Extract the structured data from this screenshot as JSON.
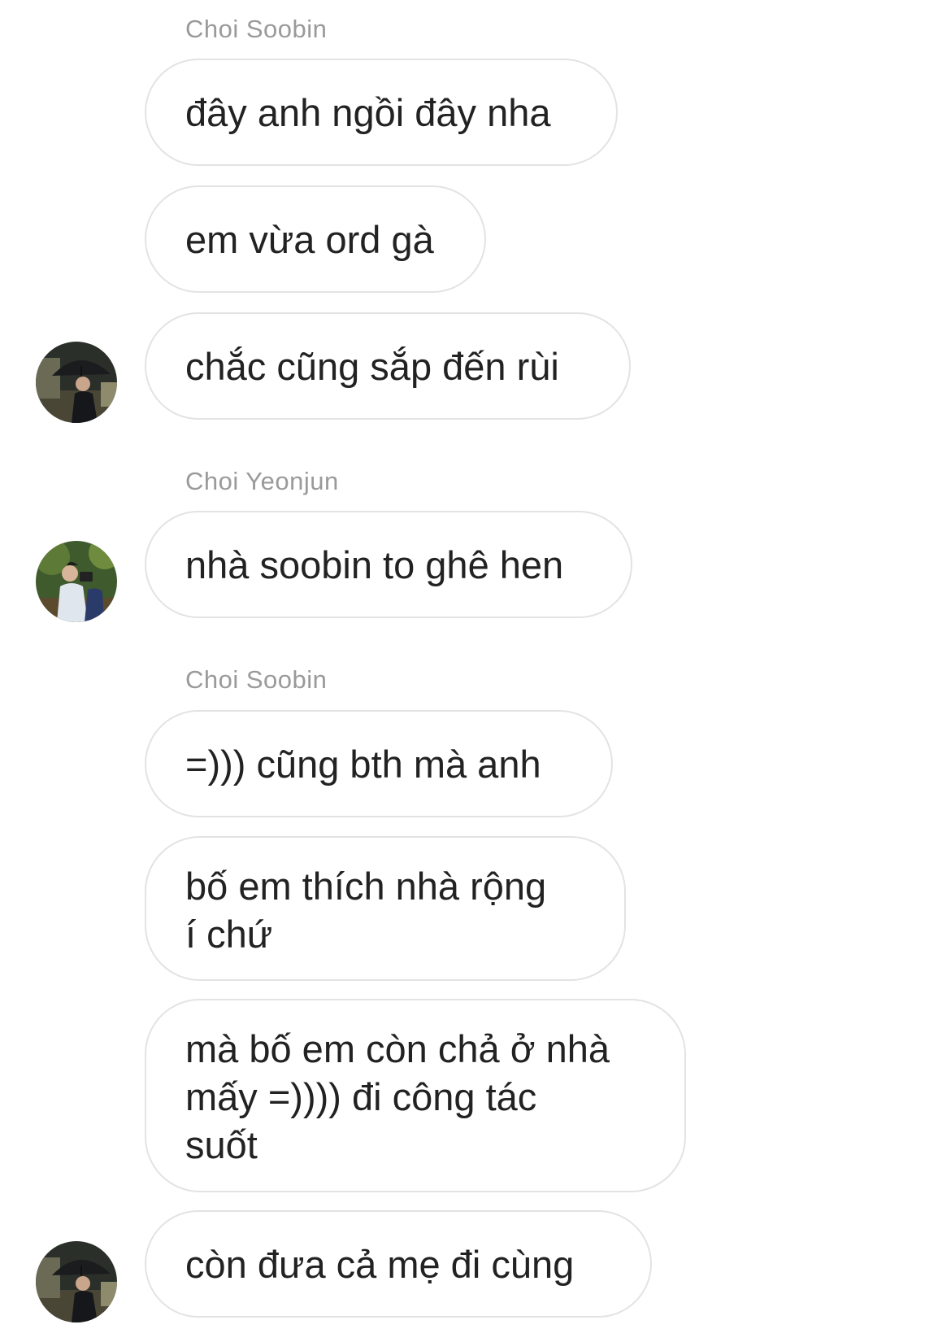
{
  "chat": {
    "groups": [
      {
        "sender": "Choi Soobin",
        "messages": [
          "đây anh ngồi đây nha",
          "em vừa ord gà",
          "chắc cũng sắp đến rùi"
        ]
      },
      {
        "sender": "Choi Yeonjun",
        "messages": [
          "nhà soobin to ghê hen"
        ]
      },
      {
        "sender": "Choi Soobin",
        "messages": [
          "=))) cũng bth mà anh",
          "bố em thích nhà rộng\ní chứ",
          "mà bố em còn chả ở nhà\nmấy =)))) đi công tác\nsuốt",
          "còn đưa cả mẹ đi cùng"
        ]
      }
    ]
  },
  "colors": {
    "bubble_border": "#e3e3e3",
    "sender_name": "#9a9a9a",
    "message_text": "#222222",
    "background": "#ffffff"
  },
  "icons": {
    "avatar_soobin": "avatar-photo-umbrella-night",
    "avatar_yeonjun": "avatar-photo-camera-park"
  }
}
